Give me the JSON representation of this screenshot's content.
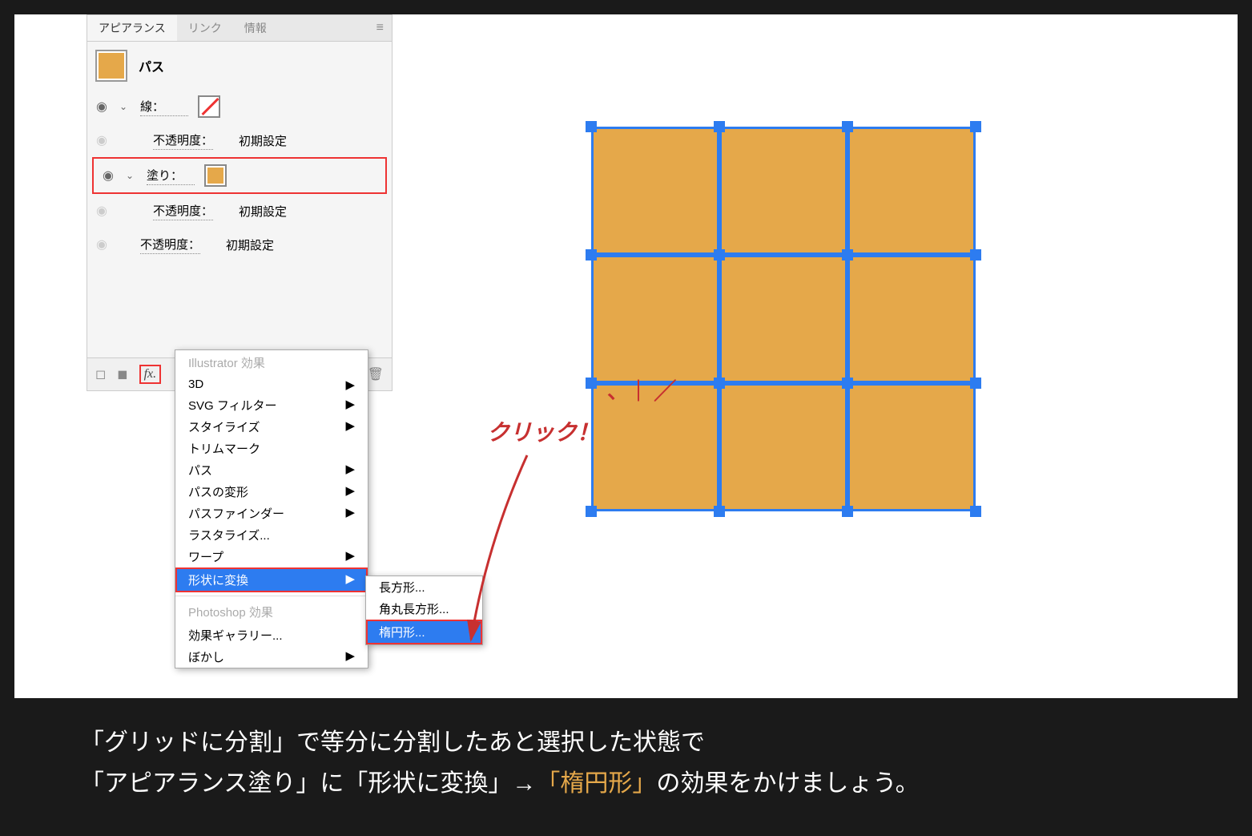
{
  "tabs": {
    "appearance": "アピアランス",
    "link": "リンク",
    "info": "情報"
  },
  "object": {
    "type": "パス"
  },
  "rows": {
    "stroke": "線：",
    "opacity": "不透明度：",
    "default": "初期設定",
    "fill": "塗り："
  },
  "fx_button": "fx.",
  "flyout": {
    "header1": "Illustrator 効果",
    "items": {
      "threeD": "3D",
      "svg": "SVG フィルター",
      "stylize": "スタイライズ",
      "trim": "トリムマーク",
      "path": "パス",
      "pathDistort": "パスの変形",
      "pathfinder": "パスファインダー",
      "rasterize": "ラスタライズ...",
      "warp": "ワープ",
      "convertShape": "形状に変換"
    },
    "header2": "Photoshop 効果",
    "items2": {
      "gallery": "効果ギャラリー...",
      "blur": "ぼかし"
    }
  },
  "submenu": {
    "rect": "長方形...",
    "roundRect": "角丸長方形...",
    "ellipse": "楕円形..."
  },
  "annotation": {
    "click": "クリック！",
    "emphasis": "、｜ ／"
  },
  "caption": {
    "line1a": "「グリッドに分割」で等分に分割したあと選択した状態で",
    "line2a": "「アピアランス塗り」に「形状に変換」→",
    "line2b": "「楕円形」",
    "line2c": "の効果をかけましょう。"
  }
}
